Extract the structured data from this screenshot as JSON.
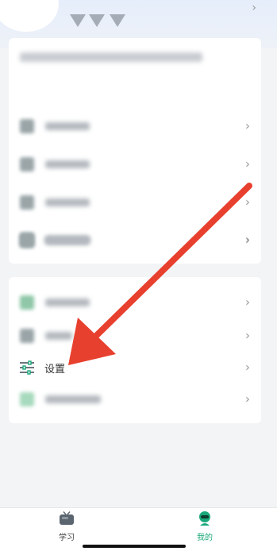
{
  "colors": {
    "accent": "#1aa87a",
    "arrow": "#e8402e",
    "chevron": "#9a9a9a"
  },
  "top": {
    "chevron_icon": "chevron-right-icon"
  },
  "card1": {
    "rows": [
      {
        "icon": "blurred-icon"
      },
      {
        "icon": "blurred-icon"
      },
      {
        "icon": "blurred-icon"
      },
      {
        "icon": "blurred-icon"
      },
      {
        "icon": "blurred-icon"
      }
    ]
  },
  "card2": {
    "settings_label": "设置",
    "settings_icon": "sliders-icon"
  },
  "chevron_glyph": "›",
  "tabbar": {
    "study_label": "学习",
    "mine_label": "我的",
    "study_icon": "tv-icon",
    "mine_icon": "person-icon"
  }
}
